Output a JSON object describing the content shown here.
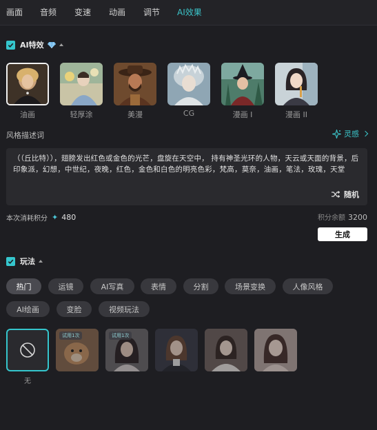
{
  "tabs": [
    {
      "label": "画面"
    },
    {
      "label": "音频"
    },
    {
      "label": "变速"
    },
    {
      "label": "动画"
    },
    {
      "label": "调节"
    },
    {
      "label": "AI效果",
      "active": true
    }
  ],
  "ai_effects": {
    "title": "AI特效",
    "checked": true,
    "items": [
      {
        "label": "油画",
        "selected": true
      },
      {
        "label": "轻厚涂"
      },
      {
        "label": "美漫"
      },
      {
        "label": "CG"
      },
      {
        "label": "漫画 I"
      },
      {
        "label": "漫画 II"
      }
    ]
  },
  "style_prompt": {
    "label": "风格描述词",
    "inspiration_label": "灵感",
    "text": "（（丘比特）），翅膀发出红色或金色的光芒，盘旋在天空中， 持有神圣光环的人物，天云或天面的背景，后印象派，幻想，中世纪，夜晚，红色，金色和白色的明亮色彩，梵高，莫奈，油画，笔法，玫瑰，天堂",
    "random_label": "随机"
  },
  "cost": {
    "label": "本次消耗积分",
    "value": "480",
    "balance_label": "积分余额",
    "balance_value": "3200"
  },
  "generate_label": "生成",
  "gameplay": {
    "title": "玩法",
    "checked": true,
    "chips_row1": [
      {
        "label": "热门",
        "active": true
      },
      {
        "label": "运镜"
      },
      {
        "label": "AI写真"
      },
      {
        "label": "表情"
      },
      {
        "label": "分割"
      },
      {
        "label": "场景变换"
      },
      {
        "label": "人像风格"
      }
    ],
    "chips_row2": [
      {
        "label": "AI绘画"
      },
      {
        "label": "变脸"
      },
      {
        "label": "视频玩法"
      }
    ],
    "none_label": "无",
    "items": [
      {
        "trial": "试用1次"
      },
      {
        "trial": "试用1次"
      },
      {},
      {},
      {}
    ]
  },
  "colors": {
    "accent": "#35c6cd",
    "background": "#1e1e22",
    "panel": "#2a2a2e"
  }
}
